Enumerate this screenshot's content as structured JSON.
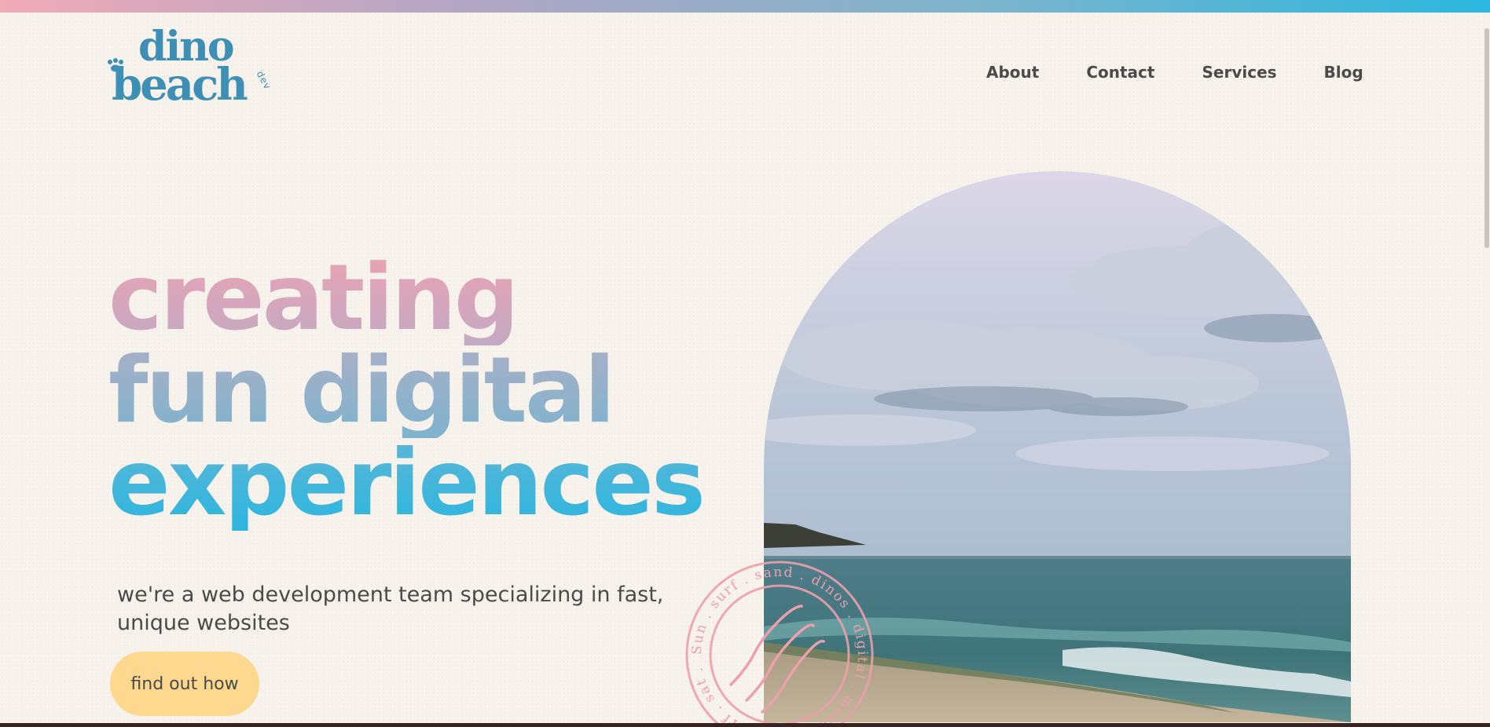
{
  "brand": {
    "logo_top": "dino",
    "logo_bottom": "beach",
    "logo_suffix": "dev"
  },
  "nav": {
    "items": [
      {
        "label": "About"
      },
      {
        "label": "Contact"
      },
      {
        "label": "Services"
      },
      {
        "label": "Blog"
      }
    ]
  },
  "hero": {
    "line1": "creating",
    "line2": "fun digital",
    "line3": "experiences",
    "subtitle": "we're a web development team specializing in fast, unique websites",
    "cta_label": "find out how"
  },
  "stamp": {
    "ring_text": "Sun . surf . sand . dinos . digital . make . sun . surf . sat ."
  },
  "colors": {
    "brand_blue": "#3e8fb5",
    "pink": "#eaa3b4",
    "cyan": "#2cb6df",
    "cta_yellow": "#fdd88e",
    "background": "#f7f3ec",
    "stamp_pink": "#eba0ab"
  }
}
